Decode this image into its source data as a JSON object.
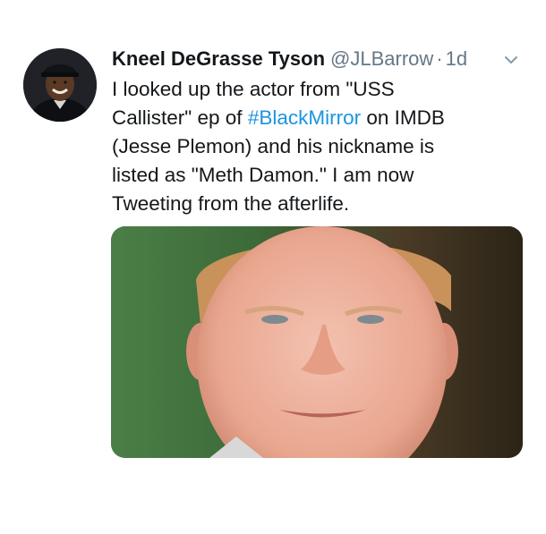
{
  "tweet": {
    "display_name": "Kneel DeGrasse Tyson",
    "handle": "@JLBarrow",
    "separator": "·",
    "time": "1d",
    "text_lines": [
      [
        "I looked up the actor from \"USS",
        "",
        ""
      ],
      [
        "Callister\" ep of ",
        "#BlackMirror",
        " on IMDB"
      ],
      [
        "(Jesse Plemon) and his nickname is",
        "",
        ""
      ],
      [
        "listed as \"Meth Damon.\" I am now",
        "",
        ""
      ],
      [
        "Tweeting from the afterlife.",
        "",
        ""
      ]
    ]
  },
  "icons": {
    "caret": "chevron-down-icon",
    "avatar": "avatar-photo",
    "media": "tweet-media-photo"
  },
  "colors": {
    "name": "#14171a",
    "secondary": "#657786",
    "hashtag": "#1b95e0",
    "background": "#ffffff"
  }
}
